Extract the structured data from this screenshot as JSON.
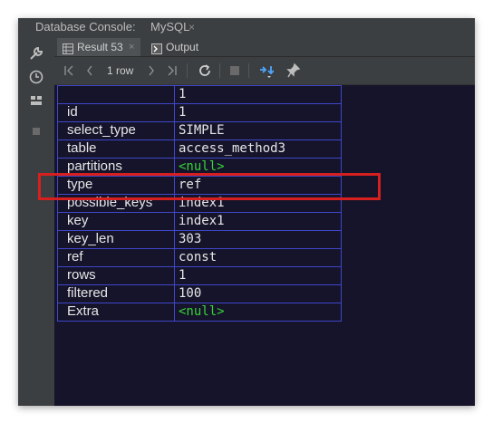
{
  "window": {
    "title": "Database Console:",
    "subtitle": "MySQL",
    "close_symbol": "×"
  },
  "tabs": [
    {
      "label": "Result 53",
      "close": "×",
      "icon": "table-icon"
    },
    {
      "label": "Output",
      "icon": "output-icon"
    }
  ],
  "toolbar": {
    "row_count": "1 row",
    "buttons": [
      "first-page-icon",
      "prev-page-icon",
      "next-page-icon",
      "last-page-icon",
      "refresh-icon",
      "stop-icon",
      "transpose-icon",
      "pin-icon"
    ]
  },
  "leftbar": {
    "icons": [
      "wrench-icon",
      "clock-icon",
      "layout-icon",
      "square-icon"
    ]
  },
  "grid": {
    "column_header": "1",
    "rows": [
      {
        "key": "id",
        "value": "1"
      },
      {
        "key": "select_type",
        "value": "SIMPLE"
      },
      {
        "key": "table",
        "value": "access_method3"
      },
      {
        "key": "partitions",
        "value": "<null>"
      },
      {
        "key": "type",
        "value": "ref"
      },
      {
        "key": "possible_keys",
        "value": "index1"
      },
      {
        "key": "key",
        "value": "index1"
      },
      {
        "key": "key_len",
        "value": "303"
      },
      {
        "key": "ref",
        "value": "const"
      },
      {
        "key": "rows",
        "value": "1"
      },
      {
        "key": "filtered",
        "value": "100"
      },
      {
        "key": "Extra",
        "value": "<null>"
      }
    ]
  },
  "colors": {
    "null_value": "#37d437",
    "highlight_box": "#d61f1f",
    "grid_border": "#3f47c8"
  }
}
